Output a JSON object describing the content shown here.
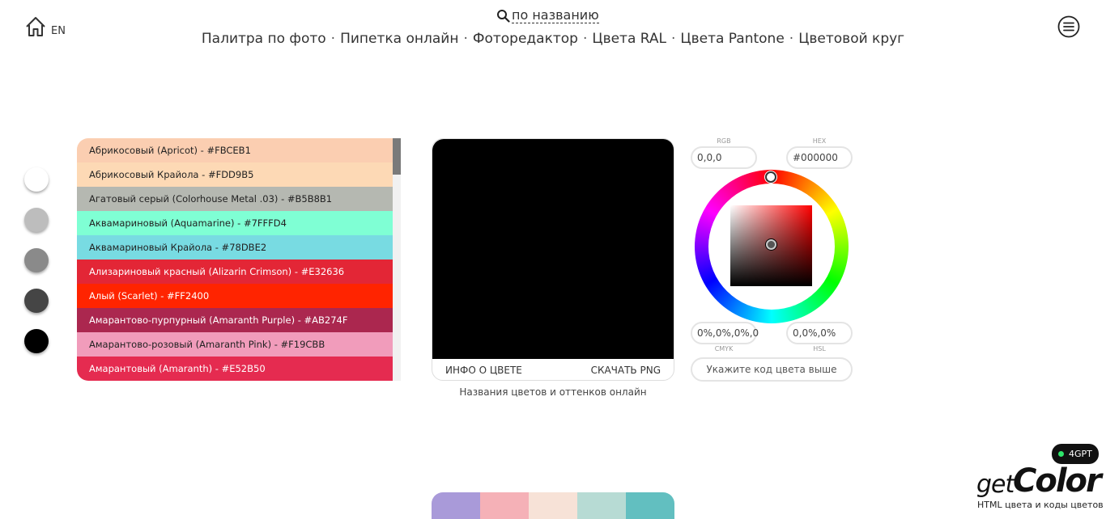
{
  "header": {
    "lang": "EN",
    "search_label": "по названию",
    "nav": [
      "Палитра по фото",
      "Пипетка онлайн",
      "Фоторедактор",
      "Цвета RAL",
      "Цвета Pantone",
      "Цветовой круг"
    ],
    "nav_separator": "·"
  },
  "shades": [
    "#ffffff",
    "#bdbdbd",
    "#8a8a8a",
    "#454545",
    "#000000"
  ],
  "color_list": [
    {
      "label": "Абрикосовый (Apricot) - #FBCEB1",
      "bg": "#FBCEB1",
      "fg": "#222222"
    },
    {
      "label": "Абрикосовый Крайола - #FDD9B5",
      "bg": "#FDD9B5",
      "fg": "#222222"
    },
    {
      "label": "Агатовый серый (Colorhouse Metal .03) - #B5B8B1",
      "bg": "#B5B8B1",
      "fg": "#222222"
    },
    {
      "label": "Аквамариновый (Aquamarine) - #7FFFD4",
      "bg": "#7FFFD4",
      "fg": "#222222"
    },
    {
      "label": "Аквамариновый Крайола - #78DBE2",
      "bg": "#78DBE2",
      "fg": "#222222"
    },
    {
      "label": "Ализариновый красный (Alizarin Crimson) - #E32636",
      "bg": "#E32636",
      "fg": "#ffffff"
    },
    {
      "label": "Алый (Scarlet) - #FF2400",
      "bg": "#FF2400",
      "fg": "#ffffff"
    },
    {
      "label": "Амарантово-пурпурный (Amaranth Purple) - #AB274F",
      "bg": "#AB274F",
      "fg": "#ffffff"
    },
    {
      "label": "Амарантово-розовый (Amaranth Pink) - #F19CBB",
      "bg": "#F19CBB",
      "fg": "#222222"
    },
    {
      "label": "Амарантовый (Amaranth) - #E52B50",
      "bg": "#E52B50",
      "fg": "#ffffff"
    }
  ],
  "preview": {
    "color": "#000000",
    "info_label": "ИНФО О ЦВЕТЕ",
    "download_label": "СКАЧАТЬ PNG",
    "caption": "Названия цветов и оттенков онлайн"
  },
  "picker": {
    "rgb_label": "RGB",
    "rgb_value": "0,0,0",
    "hex_label": "HEX",
    "hex_value": "#000000",
    "cmyk_label": "CMYK",
    "cmyk_value": "0%,0%,0%,0",
    "hsl_label": "HSL",
    "hsl_value": "0,0%,0%",
    "code_button": "Укажите код цвета выше"
  },
  "palette": [
    "#a99ad9",
    "#f5b1b7",
    "#f7e2d7",
    "#b7dbd4",
    "#62bfc0"
  ],
  "badge": {
    "label": "4GPT"
  },
  "logo": {
    "get": "get",
    "color": "Color",
    "tagline": "HTML цвета и коды цветов"
  }
}
